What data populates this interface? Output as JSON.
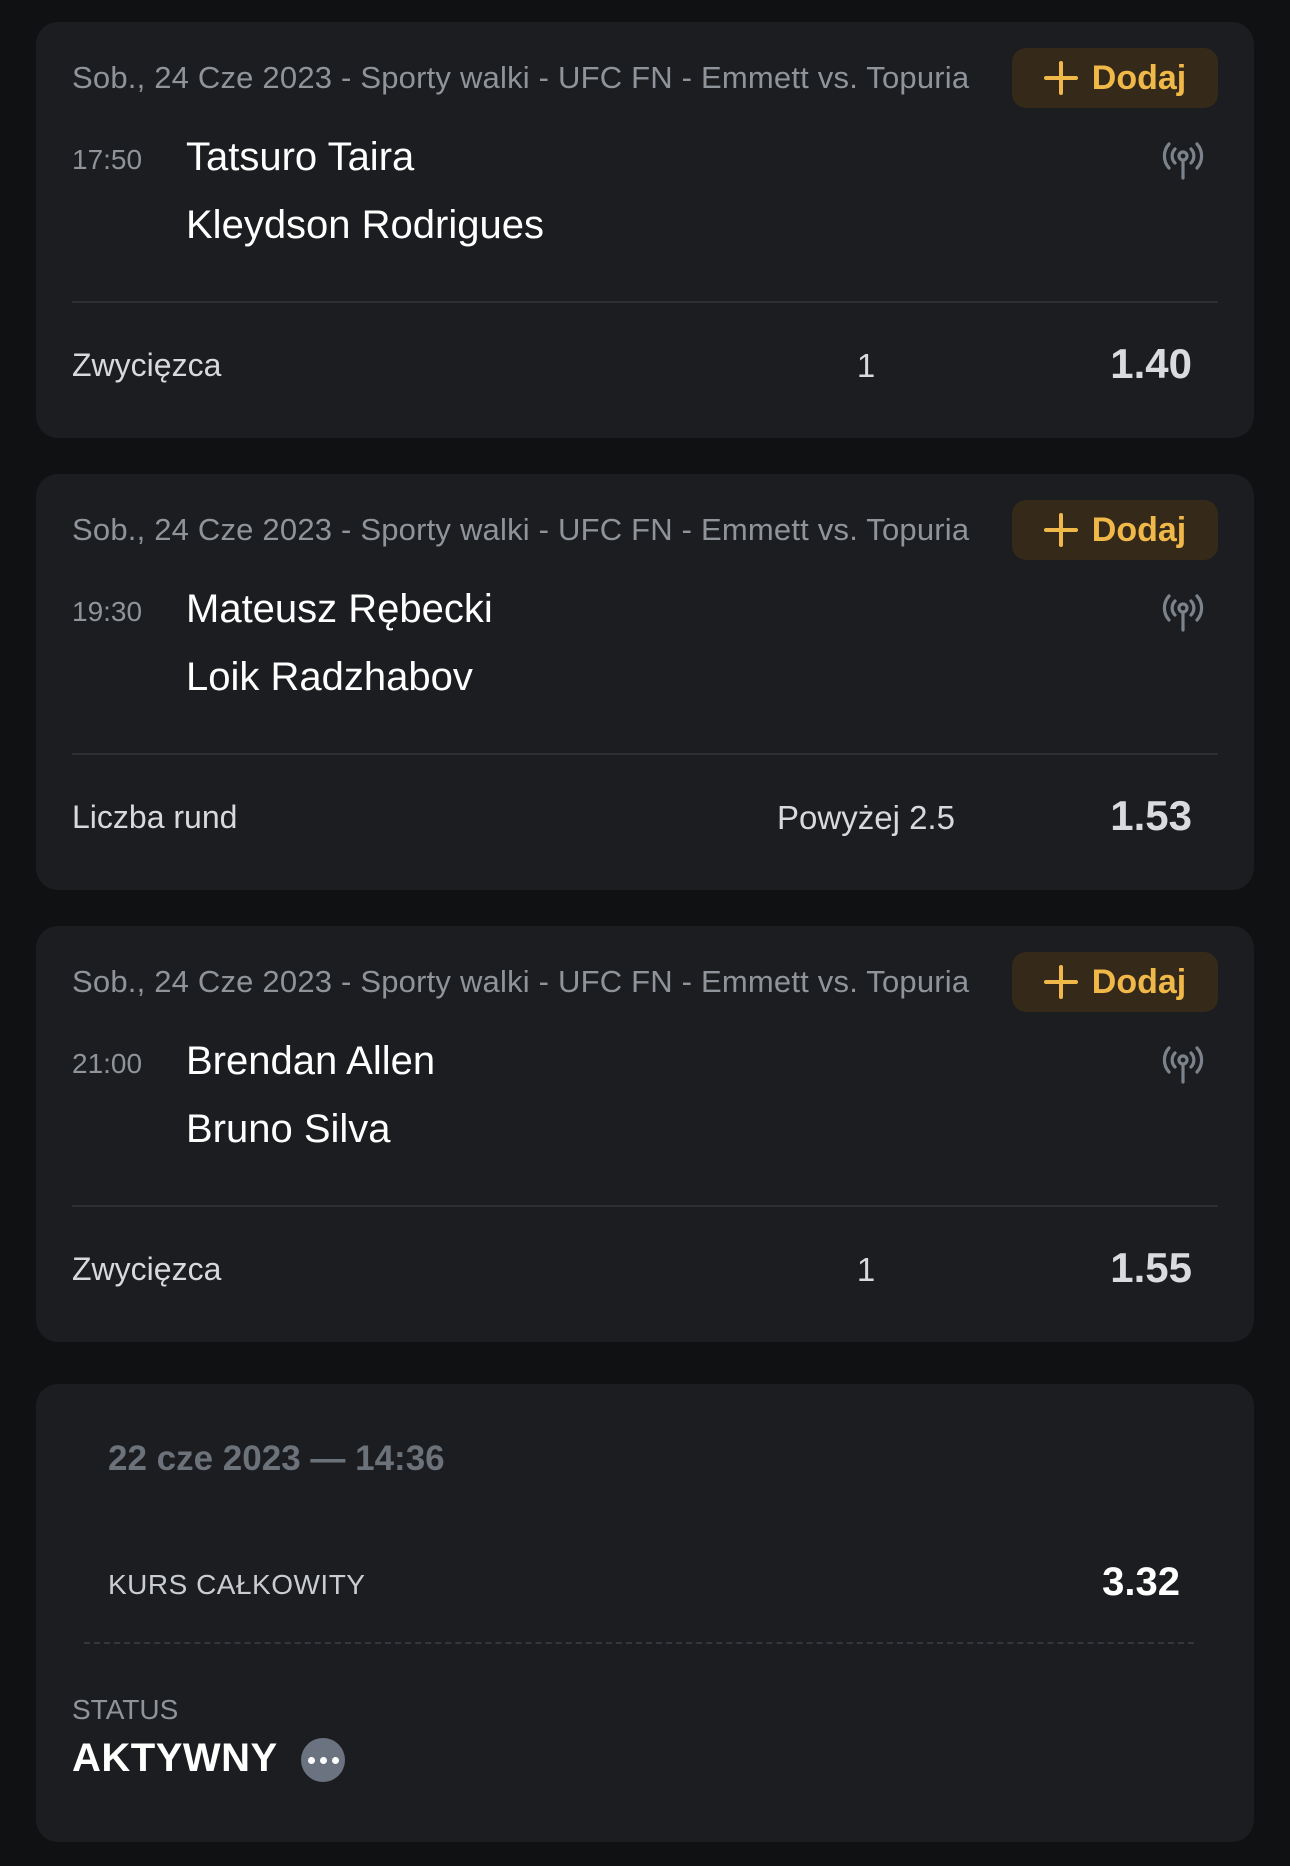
{
  "events": [
    {
      "meta": "Sob., 24 Cze 2023 - Sporty walki - UFC FN - Emmett vs. Topuria",
      "add_label": "Dodaj",
      "time": "17:50",
      "team1": "Tatsuro Taira",
      "team2": "Kleydson Rodrigues",
      "market": "Zwycięzca",
      "selection": "1",
      "odds": "1.40"
    },
    {
      "meta": "Sob., 24 Cze 2023 - Sporty walki - UFC FN - Emmett vs. Topuria",
      "add_label": "Dodaj",
      "time": "19:30",
      "team1": "Mateusz Rębecki",
      "team2": "Loik Radzhabov",
      "market": "Liczba rund",
      "selection": "Powyżej 2.5",
      "odds": "1.53"
    },
    {
      "meta": "Sob., 24 Cze 2023 - Sporty walki - UFC FN - Emmett vs. Topuria",
      "add_label": "Dodaj",
      "time": "21:00",
      "team1": "Brendan Allen",
      "team2": "Bruno Silva",
      "market": "Zwycięzca",
      "selection": "1",
      "odds": "1.55"
    }
  ],
  "summary": {
    "placed_at": "22 cze 2023 — 14:36",
    "total_odds_label": "KURS CAŁKOWITY",
    "total_odds": "3.32",
    "status_label": "STATUS",
    "status_value": "AKTYWNY"
  },
  "icons": {
    "add": "plus-icon",
    "live": "live-broadcast-icon",
    "more": "more-options-icon"
  },
  "colors": {
    "accent": "#f0b848",
    "background": "#0f1113",
    "card": "#1c1d20"
  }
}
